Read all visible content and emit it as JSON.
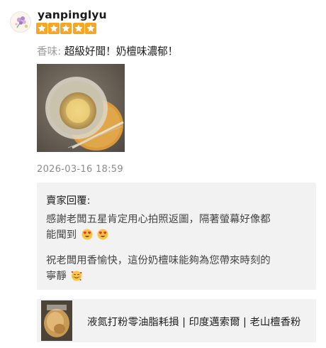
{
  "review": {
    "username": "yanpinglyu",
    "rating": 5,
    "rating_max": 5,
    "label": "香味:",
    "text": " 超級好聞！奶檀味濃郁！",
    "timestamp": "2026-03-16 18:59",
    "star_color": "#f5a623"
  },
  "seller_reply": {
    "title": "賣家回覆:",
    "lines": [
      "感謝老闆五星肯定用心拍照返圖，隔著螢幕好像都",
      "能聞到",
      "",
      "祝老闆用香愉快，這份奶檀味能夠為您帶來時刻的",
      "寧靜"
    ]
  },
  "product": {
    "title": "液氮打粉零油脂耗損 | 印度邁索爾 | 老山檀香粉"
  },
  "icons": {
    "avatar": "flower-avatar-icon",
    "star": "star-icon",
    "emoji_heart_eyes": "heart-eyes-emoji-icon",
    "emoji_smiling_hearts": "smiling-face-with-hearts-emoji-icon"
  }
}
